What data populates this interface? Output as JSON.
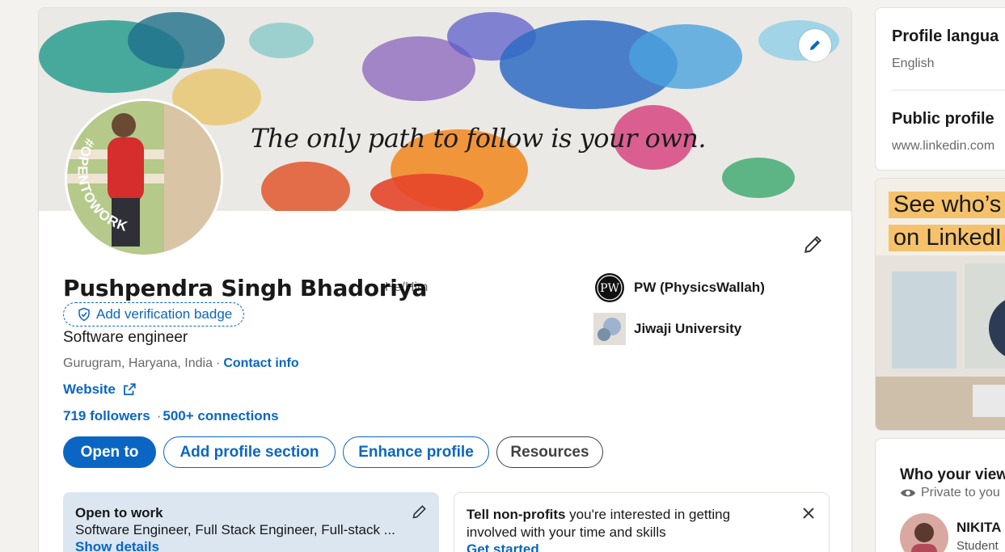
{
  "profile": {
    "banner_quote": "The only path to follow is your own.",
    "open_to_work_ring_text": "#OPENTOWORK",
    "name": "Pushpendra Singh Bhadoriya",
    "pronouns": "He/Him",
    "verification_label": "Add verification badge",
    "headline": "Software engineer",
    "location": "Gurugram, Haryana, India",
    "separator": "·",
    "contact_info": "Contact info",
    "website": "Website",
    "followers": "719 followers",
    "connections_separator": "·",
    "connections": "500+ connections"
  },
  "actions": {
    "open_to": "Open to",
    "add_section": "Add profile section",
    "enhance": "Enhance profile",
    "resources": "Resources"
  },
  "experience": [
    {
      "name": "PW (PhysicsWallah)",
      "logo_text": "PW"
    },
    {
      "name": "Jiwaji University"
    }
  ],
  "open_to_work_card": {
    "title": "Open to work",
    "roles": "Software Engineer, Full Stack Engineer, Full-stack ...",
    "link": "Show details"
  },
  "nonprofit_card": {
    "title_bold": "Tell non-profits",
    "text_rest": " you're interested in getting",
    "text_line2": "involved with your time and skills",
    "link": "Get started"
  },
  "sidebar": {
    "profile_language_title": "Profile langua",
    "profile_language_value": "English",
    "public_profile_title": "Public profile",
    "public_profile_url": "www.linkedin.com",
    "ad_line1": "See who’s",
    "ad_line2": "on LinkedI",
    "viewers_title": "Who your view",
    "viewers_private": "Private to you",
    "viewer_name": "NIKITA",
    "viewer_role": "Student"
  },
  "colors": {
    "accent": "#0a66c2",
    "open_to_work_green": "#3b7d2a",
    "page_bg": "#f4f2ee"
  },
  "icons": [
    "pencil-icon",
    "shield-check-icon",
    "external-link-icon",
    "close-icon",
    "eye-icon"
  ]
}
